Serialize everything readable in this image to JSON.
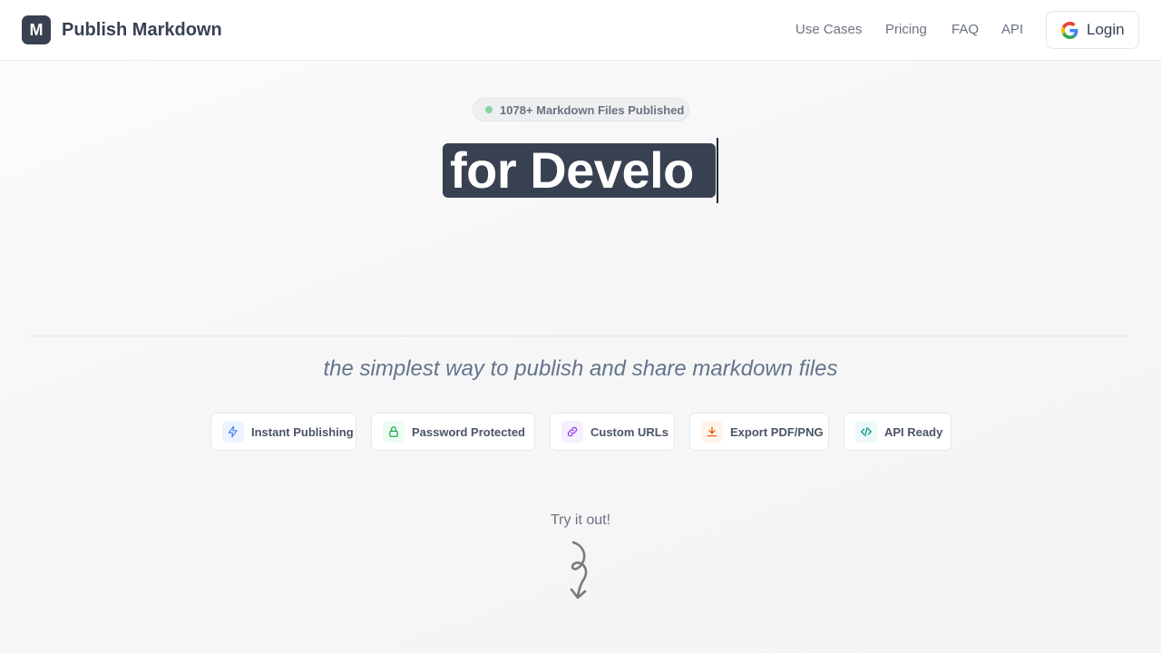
{
  "header": {
    "logo_letter": "M",
    "brand": "Publish Markdown",
    "nav": [
      {
        "label": "Use Cases"
      },
      {
        "label": "Pricing"
      },
      {
        "label": "FAQ"
      },
      {
        "label": "API"
      }
    ],
    "login_label": "Login"
  },
  "hero": {
    "badge": "1078+ Markdown Files Published",
    "badge_dot_color": "#86d4a0",
    "headline_typed": "for Develo",
    "headline_bg": "#374151",
    "tagline": "the simplest way to publish and share markdown files"
  },
  "features": [
    {
      "label": "Instant Publishing",
      "icon": "lightning-icon",
      "color": "#3b82f6",
      "bg": "#eef4ff"
    },
    {
      "label": "Password Protected",
      "icon": "lock-icon",
      "color": "#16a34a",
      "bg": "#ecfdf3"
    },
    {
      "label": "Custom URLs",
      "icon": "link-icon",
      "color": "#9333ea",
      "bg": "#f6efff"
    },
    {
      "label": "Export PDF/PNG",
      "icon": "download-icon",
      "color": "#ea580c",
      "bg": "#fff4ea"
    },
    {
      "label": "API Ready",
      "icon": "code-icon",
      "color": "#0d9488",
      "bg": "#ebfaf8"
    }
  ],
  "cta": {
    "try_label": "Try it out!"
  }
}
